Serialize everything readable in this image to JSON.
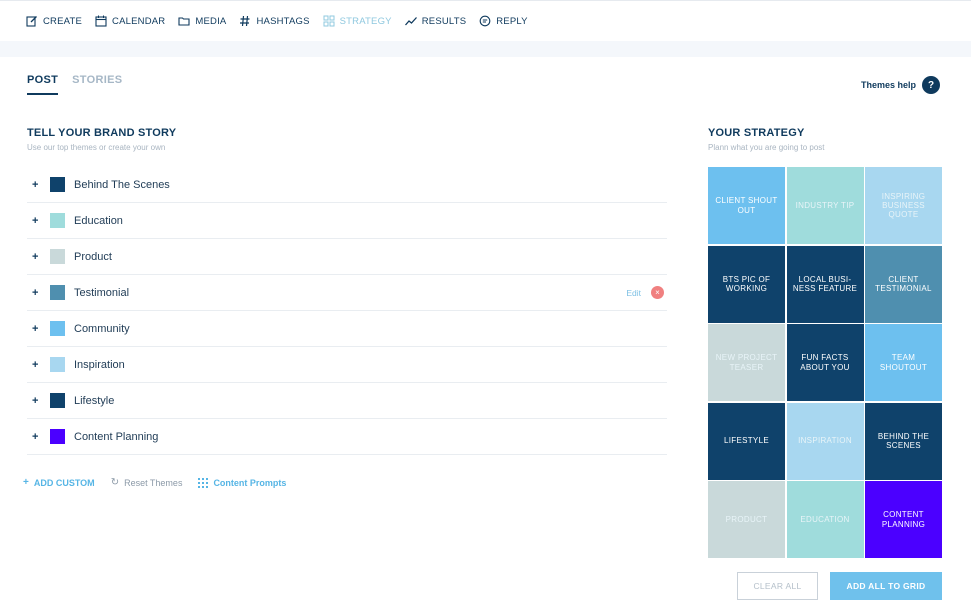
{
  "nav": [
    {
      "label": "CREATE",
      "icon": "edit-icon",
      "active": false
    },
    {
      "label": "CALENDAR",
      "icon": "calendar-icon",
      "active": false
    },
    {
      "label": "MEDIA",
      "icon": "folder-icon",
      "active": false
    },
    {
      "label": "HASHTAGS",
      "icon": "hashtag-icon",
      "active": false
    },
    {
      "label": "STRATEGY",
      "icon": "grid-icon",
      "active": true
    },
    {
      "label": "RESULTS",
      "icon": "trend-icon",
      "active": false
    },
    {
      "label": "REPLY",
      "icon": "chat-icon",
      "active": false
    }
  ],
  "tabs": {
    "post": "POST",
    "stories": "STORIES"
  },
  "themes_help": {
    "label": "Themes help",
    "icon_text": "?"
  },
  "brand": {
    "title": "TELL YOUR BRAND STORY",
    "subtitle": "Use our top themes or create your own",
    "themes": [
      {
        "label": "Behind The Scenes",
        "color": "#0f426b"
      },
      {
        "label": "Education",
        "color": "#9fdcdc"
      },
      {
        "label": "Product",
        "color": "#c9d9da"
      },
      {
        "label": "Testimonial",
        "color": "#4f8faf"
      },
      {
        "label": "Community",
        "color": "#6dc0ef"
      },
      {
        "label": "Inspiration",
        "color": "#a8d7f0"
      },
      {
        "label": "Lifestyle",
        "color": "#0f426b"
      },
      {
        "label": "Content Planning",
        "color": "#4b00ff"
      }
    ],
    "edit_label": "Edit",
    "remove_symbol": "×"
  },
  "links": {
    "add_custom": "ADD CUSTOM",
    "reset": "Reset Themes",
    "prompts": "Content Prompts"
  },
  "strategy": {
    "title": "YOUR STRATEGY",
    "subtitle": "Plann what you are going to post",
    "cells": [
      {
        "label": "CLIENT SHOUT OUT",
        "color": "#6dc0ef"
      },
      {
        "label": "INDUSTRY TIP",
        "color": "#9fdcdc"
      },
      {
        "label": "INSPIRING BUSINESS QUOTE",
        "color": "#a8d7f0"
      },
      {
        "label": "BTS PIC OF WORKING",
        "color": "#0f426b"
      },
      {
        "label": "LOCAL BUSI- NESS FEATURE",
        "color": "#0f426b"
      },
      {
        "label": "CLIENT TESTIMONIAL",
        "color": "#4f8faf"
      },
      {
        "label": "NEW PROJECT TEASER",
        "color": "#c9d9da"
      },
      {
        "label": "FUN FACTS ABOUT YOU",
        "color": "#0f426b"
      },
      {
        "label": "TEAM SHOUTOUT",
        "color": "#6dc0ef"
      },
      {
        "label": "LIFESTYLE",
        "color": "#0f426b"
      },
      {
        "label": "INSPIRATION",
        "color": "#a8d7f0"
      },
      {
        "label": "BEHIND THE SCENES",
        "color": "#0f426b"
      },
      {
        "label": "PRODUCT",
        "color": "#c9d9da"
      },
      {
        "label": "EDUCATION",
        "color": "#9fdcdc"
      },
      {
        "label": "CONTENT PLANNING",
        "color": "#4b00ff"
      }
    ]
  },
  "buttons": {
    "clear_all": "CLEAR ALL",
    "add_all": "ADD ALL TO GRID"
  }
}
